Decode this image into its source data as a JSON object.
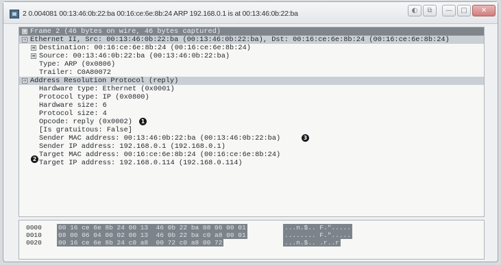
{
  "window": {
    "title": "2 0.004081 00:13:46:0b:22:ba 00:16:ce:6e:8b:24 ARP 192.168.0.1 is at 00:13:46:0b:22:ba",
    "button_glyphs": [
      "◐",
      "⧉",
      "—",
      "□",
      "✕"
    ]
  },
  "tree": {
    "rows": [
      {
        "toggle": "⊞",
        "text": "Frame 2 (46 bytes on wire, 46 bytes captured)"
      },
      {
        "toggle": "⊟",
        "text": "Ethernet II, Src: 00:13:46:0b:22:ba (00:13:46:0b:22:ba), Dst: 00:16:ce:6e:8b:24 (00:16:ce:6e:8b:24)"
      },
      {
        "toggle": "⊞",
        "text": "Destination: 00:16:ce:6e:8b:24 (00:16:ce:6e:8b:24)"
      },
      {
        "toggle": "⊞",
        "text": "Source: 00:13:46:0b:22:ba (00:13:46:0b:22:ba)"
      },
      {
        "text": "Type: ARP (0x0806)"
      },
      {
        "text": "Trailer: C0A80072"
      },
      {
        "toggle": "⊟",
        "text": "Address Resolution Protocol (reply)"
      },
      {
        "text": "Hardware type: Ethernet (0x0001)"
      },
      {
        "text": "Protocol type: IP (0x0800)"
      },
      {
        "text": "Hardware size: 6"
      },
      {
        "text": "Protocol size: 4"
      },
      {
        "text": "Opcode: reply (0x0002)"
      },
      {
        "text": "[Is gratuitous: False]"
      },
      {
        "text": "Sender MAC address: 00:13:46:0b:22:ba (00:13:46:0b:22:ba)"
      },
      {
        "text": "Sender IP address: 192.168.0.1 (192.168.0.1)"
      },
      {
        "text": "Target MAC address: 00:16:ce:6e:8b:24 (00:16:ce:6e:8b:24)"
      },
      {
        "text": "Target IP address: 192.168.0.114 (192.168.0.114)"
      }
    ],
    "markers": [
      "1",
      "2",
      "3"
    ]
  },
  "hex": {
    "rows": [
      {
        "offset": "0000",
        "bytes": "00 16 ce 6e 8b 24 00 13  46 0b 22 ba 08 06 00 01",
        "ascii": "...n.$.. F.\"....."
      },
      {
        "offset": "0010",
        "bytes": "08 00 06 04 00 02 00 13  46 0b 22 ba c0 a8 00 01",
        "ascii": "........ F.\"....."
      },
      {
        "offset": "0020",
        "bytes": "00 16 ce 6e 8b 24 c0 a8  00 72 c0 a8 00 72",
        "ascii": "...n.$.. .r..r"
      }
    ]
  },
  "colors": {
    "selection": "#7f858b",
    "highlight": "#c9cfd5",
    "pane_background": "#f7f7f6"
  }
}
